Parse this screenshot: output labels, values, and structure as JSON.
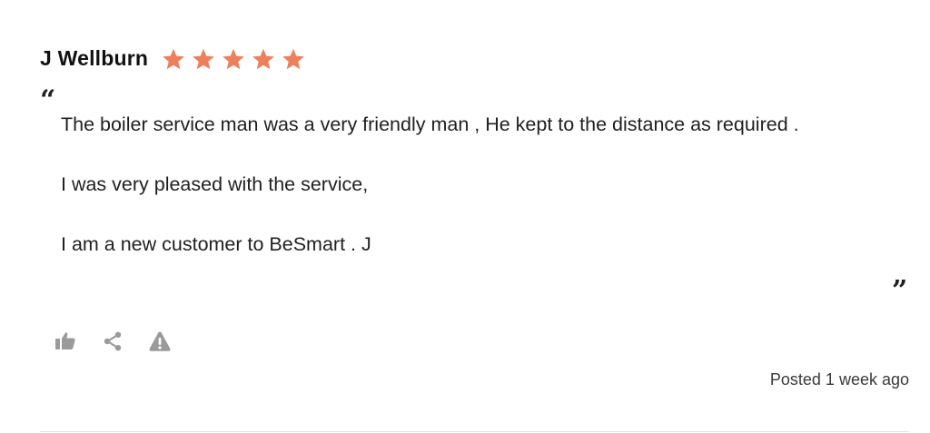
{
  "review": {
    "author": "J Wellburn",
    "rating": 5,
    "rating_max": 5,
    "star_color": "#ee7f5a",
    "quote_open": "“",
    "quote_close": "”",
    "paragraphs": [
      "The boiler service man was a very friendly man , He kept to the distance as required .",
      "I was very pleased with the service,",
      "I am a new customer to BeSmart . J"
    ],
    "posted": "Posted 1 week ago"
  },
  "actions": {
    "icons": [
      "thumbs-up-icon",
      "share-icon",
      "warning-icon"
    ],
    "icon_color": "#9a9a9a"
  }
}
